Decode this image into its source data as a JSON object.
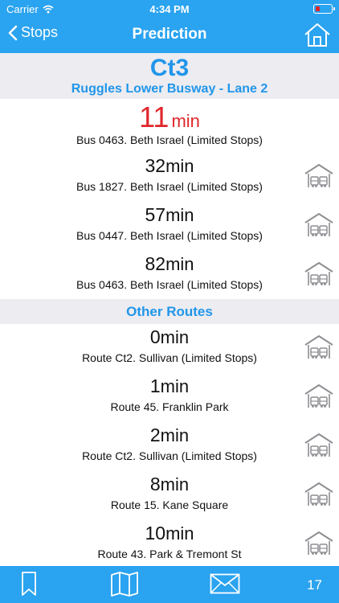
{
  "status_bar": {
    "carrier": "Carrier",
    "time": "4:34 PM"
  },
  "nav": {
    "back_label": "Stops",
    "title": "Prediction"
  },
  "route": {
    "name": "Ct3",
    "stop": "Ruggles Lower Busway - Lane 2"
  },
  "predictions": [
    {
      "minutes": "11",
      "unit": "min",
      "description": "Bus 0463. Beth Israel (Limited Stops)",
      "garage_icon": false
    },
    {
      "minutes": "32",
      "unit": "min",
      "description": "Bus 1827. Beth Israel (Limited Stops)",
      "garage_icon": true
    },
    {
      "minutes": "57",
      "unit": "min",
      "description": "Bus 0447. Beth Israel (Limited Stops)",
      "garage_icon": true
    },
    {
      "minutes": "82",
      "unit": "min",
      "description": "Bus 0463. Beth Israel (Limited Stops)",
      "garage_icon": true
    }
  ],
  "other_routes": {
    "header": "Other Routes",
    "items": [
      {
        "minutes": "0",
        "unit": "min",
        "description": "Route Ct2. Sullivan (Limited Stops)"
      },
      {
        "minutes": "1",
        "unit": "min",
        "description": "Route 45. Franklin Park"
      },
      {
        "minutes": "2",
        "unit": "min",
        "description": "Route Ct2. Sullivan (Limited Stops)"
      },
      {
        "minutes": "8",
        "unit": "min",
        "description": "Route 15. Kane Square"
      },
      {
        "minutes": "10",
        "unit": "min",
        "description": "Route 43. Park & Tremont St"
      }
    ]
  },
  "tabbar": {
    "count": "17"
  },
  "colors": {
    "accent": "#2aa3f0",
    "highlight": "#e0262b",
    "section_bg": "#ececf1",
    "route_text": "#2196ea"
  }
}
